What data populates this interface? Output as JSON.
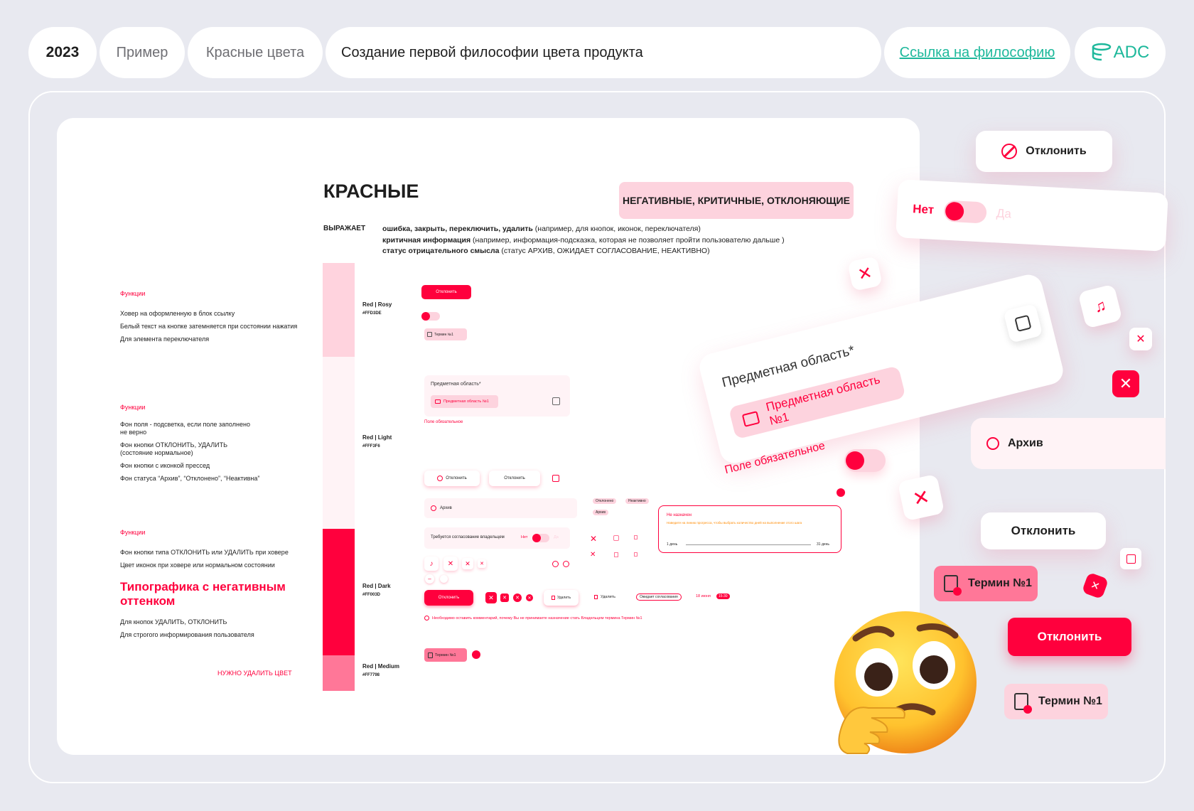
{
  "header": {
    "year": "2023",
    "example_tab": "Пример",
    "red_colors_tab": "Красные цвета",
    "title": "Создание первой философии цвета продукта",
    "link": "Ссылка  на философию",
    "logo_text": "ADC"
  },
  "colors": {
    "accent": "#ff003d",
    "rosy": "#ffd3de",
    "light": "#fff3f6",
    "dark": "#ff003d",
    "medium": "#ff7798",
    "teal": "#1db89b"
  },
  "doc": {
    "title": "КРАСНЫЕ",
    "badge": "НЕГАТИВНЫЕ, КРИТИЧНЫЕ, ОТКЛОНЯЮЩИЕ",
    "expresses_label": "ВЫРАЖАЕТ",
    "expr1_bold": "ошибка, закрыть, переключить, удалить",
    "expr1_rest": " (например, для кнопок, иконок, переключателя)",
    "expr2_bold": "критичная информация",
    "expr2_rest": "  (например, информация-подсказка, которая не позволяет пройти пользователю дальше )",
    "expr3_bold": "статус отрицательного смысла",
    "expr3_rest": " (статус АРХИВ, ОЖИДАЕТ СОГЛАСОВАНИЕ, НЕАКТИВНО)",
    "func1": {
      "title": "Функции",
      "items": [
        "Ховер на оформленную в блок ссылку",
        "Белый текст на кнопке затемняется при состоянии нажатия",
        "Для элемента переключателя"
      ]
    },
    "func2": {
      "title": "Функции",
      "items": [
        "Фон поля - подсветка, если поле заполнено",
        "не верно",
        "Фон кнопки ОТКЛОНИТЬ, УДАЛИТЬ",
        "(состояние нормальное)",
        "Фон кнопки с иконкой прессед",
        "Фон статуса “Архив”, “Отклонено”, “Неактивна”"
      ]
    },
    "func3": {
      "title": "Функции",
      "items": [
        "Фон кнопки типа ОТКЛОНИТЬ или УДАЛИТЬ при ховере",
        "Цвет иконок при ховере или нормальном состоянии"
      ],
      "typo": "Типографика с негативным оттенком",
      "items2": [
        "Для кнопок УДАЛИТЬ, ОТКЛОНИТЬ",
        "Для строгого информирования пользователя"
      ]
    },
    "delete_color": "НУЖНО УДАЛИТЬ ЦВЕТ",
    "swatches": [
      {
        "name": "Red | Rosy",
        "hex": "#FFD3DE"
      },
      {
        "name": "Red | Light",
        "hex": "#FFF3F6"
      },
      {
        "name": "Red | Dark",
        "hex": "#FF003D"
      },
      {
        "name": "Red | Medium",
        "hex": "#FF7798"
      }
    ],
    "demo": {
      "reject": "Отклонить",
      "term": "Термин №1",
      "subject_label": "Предметная область*",
      "subject_value": "Предметная область №1",
      "required": "Поле обязательное",
      "archive": "Архив",
      "rejected": "Отклонено",
      "inactive": "Неактивно",
      "owner_approval": "Требуется согласование владельцем",
      "no": "Нет",
      "yes": "Да",
      "not_assigned": "Не назначен",
      "hint": "Наведите на линию прогресса, чтобы выбрать количество дней на выполнение этого шага",
      "day1": "1 день",
      "day31": "31 день",
      "delete": "Удалить",
      "awaiting": "Ожидает согласования",
      "date": "18 июня",
      "time": "15:30",
      "comment": "Необходимо оставить комментарий, почему Вы не принимаете назначение стать Владельцем термина Термин №1"
    }
  },
  "right": {
    "reject": "Отклонить",
    "no": "Нет",
    "yes": "Да",
    "subject_label": "Предметная область*",
    "subject_value": "Предметная область №1",
    "required": "Поле обязательное",
    "archive": "Архив",
    "term": "Термин №1"
  }
}
